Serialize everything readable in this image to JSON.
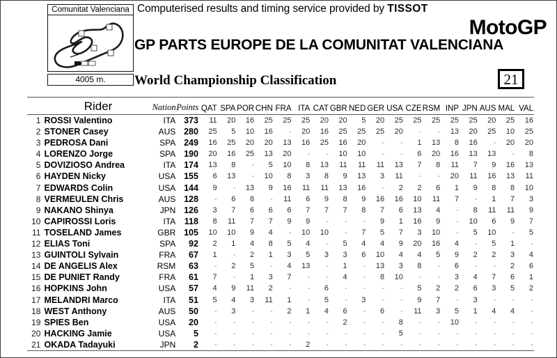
{
  "header": {
    "circuit_name": "Comunitat Valenciana",
    "circuit_length": "4005 m.",
    "timing_text": "Computerised results and timing service provided by ",
    "timing_brand": "TISSOT",
    "series": "MotoGP",
    "event_title": "GP PARTS EUROPE DE LA COMUNITAT VALENCIANA",
    "classification_title": "World Championship Classification",
    "round_number": "21"
  },
  "table": {
    "headers": {
      "rider": "Rider",
      "nation": "Nation",
      "points": "Points",
      "races": [
        "QAT",
        "SPA",
        "POR",
        "CHN",
        "FRA",
        "ITA",
        "CAT",
        "GBR",
        "NED",
        "GER",
        "USA",
        "CZE",
        "RSM",
        "INP",
        "JPN",
        "AUS",
        "MAL",
        "VAL"
      ]
    },
    "rows": [
      {
        "pos": "1",
        "rider": "ROSSI Valentino",
        "nation": "ITA",
        "points": "373",
        "scores": [
          "11",
          "20",
          "16",
          "25",
          "25",
          "25",
          "20",
          "20",
          "5",
          "20",
          "25",
          "25",
          "25",
          "25",
          "25",
          "20",
          "25",
          "16"
        ]
      },
      {
        "pos": "2",
        "rider": "STONER Casey",
        "nation": "AUS",
        "points": "280",
        "scores": [
          "25",
          "5",
          "10",
          "16",
          "-",
          "20",
          "16",
          "25",
          "25",
          "25",
          "20",
          "-",
          "-",
          "13",
          "20",
          "25",
          "10",
          "25"
        ]
      },
      {
        "pos": "3",
        "rider": "PEDROSA Dani",
        "nation": "SPA",
        "points": "249",
        "scores": [
          "16",
          "25",
          "20",
          "20",
          "13",
          "16",
          "25",
          "16",
          "20",
          "-",
          "-",
          "1",
          "13",
          "8",
          "16",
          "-",
          "20",
          "20"
        ]
      },
      {
        "pos": "4",
        "rider": "LORENZO Jorge",
        "nation": "SPA",
        "points": "190",
        "scores": [
          "20",
          "16",
          "25",
          "13",
          "20",
          "-",
          "-",
          "10",
          "10",
          "-",
          "-",
          "6",
          "20",
          "16",
          "13",
          "13",
          "-",
          "8"
        ]
      },
      {
        "pos": "5",
        "rider": "DOVIZIOSO Andrea",
        "nation": "ITA",
        "points": "174",
        "scores": [
          "13",
          "8",
          "-",
          "5",
          "10",
          "8",
          "13",
          "11",
          "11",
          "11",
          "13",
          "7",
          "8",
          "11",
          "7",
          "9",
          "16",
          "13"
        ]
      },
      {
        "pos": "6",
        "rider": "HAYDEN Nicky",
        "nation": "USA",
        "points": "155",
        "scores": [
          "6",
          "13",
          "-",
          "10",
          "8",
          "3",
          "8",
          "9",
          "13",
          "3",
          "11",
          "-",
          "-",
          "20",
          "11",
          "16",
          "13",
          "11"
        ]
      },
      {
        "pos": "7",
        "rider": "EDWARDS Colin",
        "nation": "USA",
        "points": "144",
        "scores": [
          "9",
          "-",
          "13",
          "9",
          "16",
          "11",
          "11",
          "13",
          "16",
          "-",
          "2",
          "2",
          "6",
          "1",
          "9",
          "8",
          "8",
          "10"
        ]
      },
      {
        "pos": "8",
        "rider": "VERMEULEN Chris",
        "nation": "AUS",
        "points": "128",
        "scores": [
          "-",
          "6",
          "8",
          "-",
          "11",
          "6",
          "9",
          "8",
          "9",
          "16",
          "16",
          "10",
          "11",
          "7",
          "-",
          "1",
          "7",
          "3"
        ]
      },
      {
        "pos": "9",
        "rider": "NAKANO Shinya",
        "nation": "JPN",
        "points": "126",
        "scores": [
          "3",
          "7",
          "6",
          "6",
          "6",
          "7",
          "7",
          "7",
          "8",
          "7",
          "6",
          "13",
          "4",
          "-",
          "8",
          "11",
          "11",
          "9"
        ]
      },
      {
        "pos": "10",
        "rider": "CAPIROSSI Loris",
        "nation": "ITA",
        "points": "118",
        "scores": [
          "8",
          "11",
          "7",
          "7",
          "9",
          "9",
          "-",
          "-",
          "-",
          "9",
          "1",
          "16",
          "9",
          "-",
          "10",
          "6",
          "9",
          "7"
        ]
      },
      {
        "pos": "11",
        "rider": "TOSELAND James",
        "nation": "GBR",
        "points": "105",
        "scores": [
          "10",
          "10",
          "9",
          "4",
          "-",
          "10",
          "10",
          "-",
          "7",
          "5",
          "7",
          "3",
          "10",
          "-",
          "5",
          "10",
          "-",
          "5"
        ]
      },
      {
        "pos": "12",
        "rider": "ELIAS Toni",
        "nation": "SPA",
        "points": "92",
        "scores": [
          "2",
          "1",
          "4",
          "8",
          "5",
          "4",
          "-",
          "5",
          "4",
          "4",
          "9",
          "20",
          "16",
          "4",
          "-",
          "5",
          "1",
          "-"
        ]
      },
      {
        "pos": "13",
        "rider": "GUINTOLI Sylvain",
        "nation": "FRA",
        "points": "67",
        "scores": [
          "1",
          "-",
          "2",
          "1",
          "3",
          "5",
          "3",
          "3",
          "6",
          "10",
          "4",
          "4",
          "5",
          "9",
          "2",
          "2",
          "3",
          "4"
        ]
      },
      {
        "pos": "14",
        "rider": "DE ANGELIS Alex",
        "nation": "RSM",
        "points": "63",
        "scores": [
          "-",
          "2",
          "5",
          "-",
          "4",
          "13",
          "-",
          "1",
          "-",
          "13",
          "3",
          "8",
          "-",
          "6",
          "-",
          "-",
          "2",
          "6"
        ]
      },
      {
        "pos": "15",
        "rider": "DE PUNIET Randy",
        "nation": "FRA",
        "points": "61",
        "scores": [
          "7",
          "-",
          "1",
          "3",
          "7",
          "-",
          "-",
          "4",
          "-",
          "8",
          "10",
          "-",
          "-",
          "3",
          "4",
          "7",
          "6",
          "1"
        ]
      },
      {
        "pos": "16",
        "rider": "HOPKINS John",
        "nation": "USA",
        "points": "57",
        "scores": [
          "4",
          "9",
          "11",
          "2",
          "-",
          "-",
          "6",
          "-",
          "-",
          "-",
          "-",
          "5",
          "2",
          "2",
          "6",
          "3",
          "5",
          "2"
        ]
      },
      {
        "pos": "17",
        "rider": "MELANDRI Marco",
        "nation": "ITA",
        "points": "51",
        "scores": [
          "5",
          "4",
          "3",
          "11",
          "1",
          "-",
          "5",
          "-",
          "3",
          "-",
          "-",
          "9",
          "7",
          "-",
          "3",
          "-",
          "-",
          "-"
        ]
      },
      {
        "pos": "18",
        "rider": "WEST Anthony",
        "nation": "AUS",
        "points": "50",
        "scores": [
          "-",
          "3",
          "-",
          "-",
          "2",
          "1",
          "4",
          "6",
          "-",
          "6",
          "-",
          "11",
          "3",
          "5",
          "1",
          "4",
          "4",
          "-"
        ]
      },
      {
        "pos": "19",
        "rider": "SPIES Ben",
        "nation": "USA",
        "points": "20",
        "scores": [
          "-",
          "-",
          "-",
          "-",
          "-",
          "-",
          "-",
          "2",
          "-",
          "-",
          "8",
          "-",
          "-",
          "10",
          "-",
          "-",
          "-",
          "-"
        ]
      },
      {
        "pos": "20",
        "rider": "HACKING Jamie",
        "nation": "USA",
        "points": "5",
        "scores": [
          "-",
          "-",
          "-",
          "-",
          "-",
          "-",
          "-",
          "-",
          "-",
          "-",
          "5",
          "-",
          "-",
          "-",
          "-",
          "-",
          "-",
          "-"
        ]
      },
      {
        "pos": "21",
        "rider": "OKADA Tadayuki",
        "nation": "JPN",
        "points": "2",
        "scores": [
          "-",
          "-",
          "-",
          "-",
          "-",
          "2",
          "-",
          "-",
          "-",
          "-",
          "-",
          "-",
          "-",
          "-",
          "-",
          "-",
          "-",
          "-"
        ]
      }
    ]
  }
}
